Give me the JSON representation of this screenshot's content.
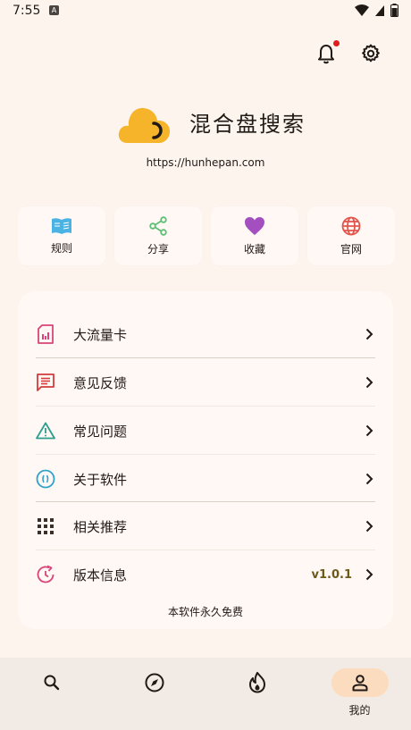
{
  "status_bar": {
    "time": "7:55",
    "notif_glyph": "A"
  },
  "header": {
    "icons": [
      "bell-icon",
      "gear-icon"
    ],
    "has_notification": true
  },
  "brand": {
    "title": "混合盘搜索",
    "url": "https://hunhepan.com",
    "logo_color": "#f5b429"
  },
  "shortcuts": [
    {
      "label": "规则",
      "icon": "book-icon",
      "color": "#4ab3e3"
    },
    {
      "label": "分享",
      "icon": "share-icon",
      "color": "#5cbf74"
    },
    {
      "label": "收藏",
      "icon": "heart-icon",
      "color": "#a34fbf"
    },
    {
      "label": "官网",
      "icon": "globe-icon",
      "color": "#e2564d"
    }
  ],
  "menu": [
    {
      "label": "大流量卡",
      "icon": "sim-card-icon",
      "color": "#d9447a"
    },
    {
      "label": "意见反馈",
      "icon": "feedback-icon",
      "color": "#d43b3b"
    },
    {
      "label": "常见问题",
      "icon": "warning-icon",
      "color": "#2f9e8f"
    },
    {
      "label": "关于软件",
      "icon": "about-icon",
      "color": "#2fa3c8"
    },
    {
      "label": "相关推荐",
      "icon": "grid-icon",
      "color": "#3b2f2a"
    },
    {
      "label": "版本信息",
      "icon": "update-icon",
      "color": "#d9447a",
      "value": "v1.0.1"
    }
  ],
  "footer_note": "本软件永久免费",
  "bottom_nav": [
    {
      "icon": "search-icon",
      "label": ""
    },
    {
      "icon": "compass-icon",
      "label": ""
    },
    {
      "icon": "fire-icon",
      "label": ""
    },
    {
      "icon": "person-icon",
      "label": "我的",
      "active": true
    }
  ]
}
